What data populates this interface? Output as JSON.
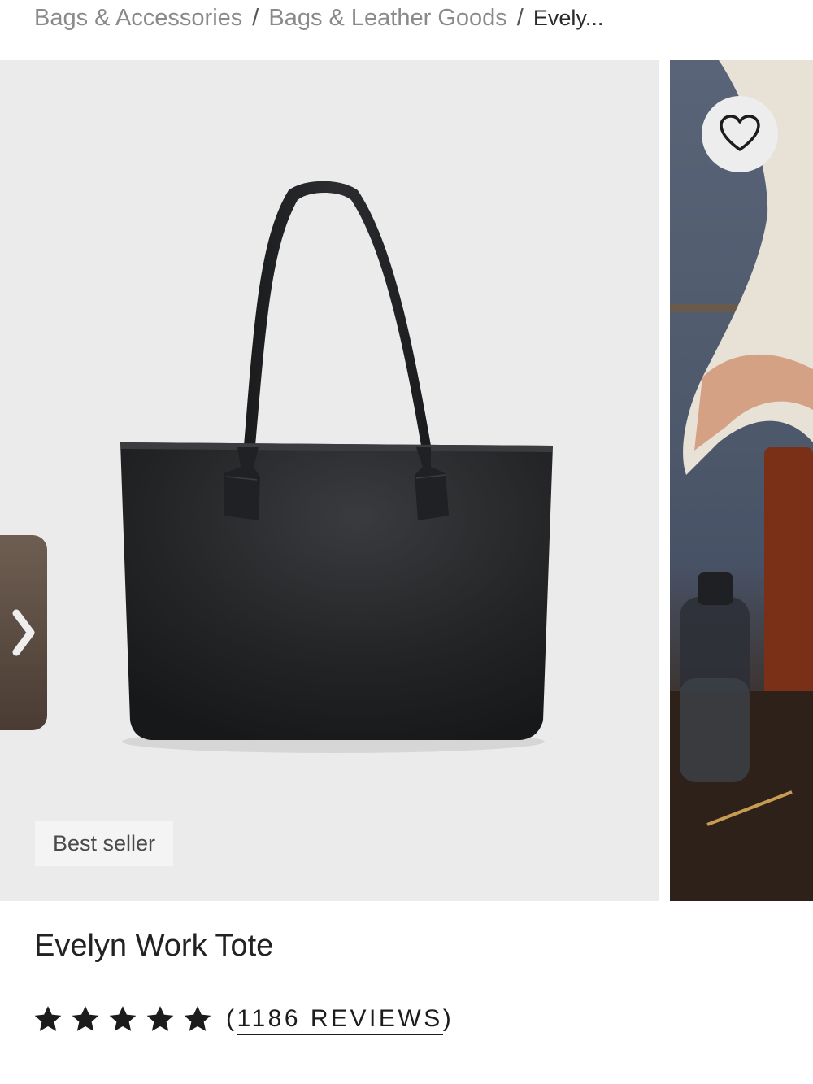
{
  "breadcrumb": {
    "items": [
      "Bags & Accessories",
      "Bags & Leather Goods"
    ],
    "separator": "/",
    "current": "Evely..."
  },
  "gallery": {
    "badge": "Best seller",
    "icons": {
      "favorite": "heart-icon",
      "previous": "chevron-right-icon"
    },
    "colors": {
      "main_background": "#ebebeb",
      "bag": "#1f2022"
    }
  },
  "product": {
    "title": "Evelyn Work Tote",
    "rating": {
      "stars": 5,
      "reviews_open": "(",
      "reviews_text": "1186 REVIEWS",
      "reviews_close": ")"
    }
  }
}
